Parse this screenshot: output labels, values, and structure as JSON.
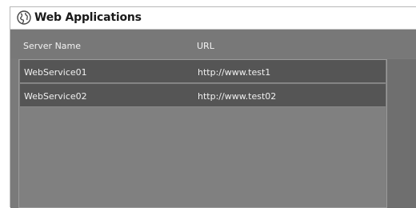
{
  "window": {
    "title": "Web Applications",
    "icon": "globe-icon"
  },
  "table": {
    "columns": [
      "Server Name",
      "URL"
    ],
    "rows": [
      {
        "name": "WebService01",
        "url": "http://www.test1"
      },
      {
        "name": "WebService02",
        "url": "http://www.test02"
      }
    ]
  },
  "colors": {
    "background": "#7a7a7a",
    "row": "#555555",
    "text": "#f0f0f0"
  }
}
